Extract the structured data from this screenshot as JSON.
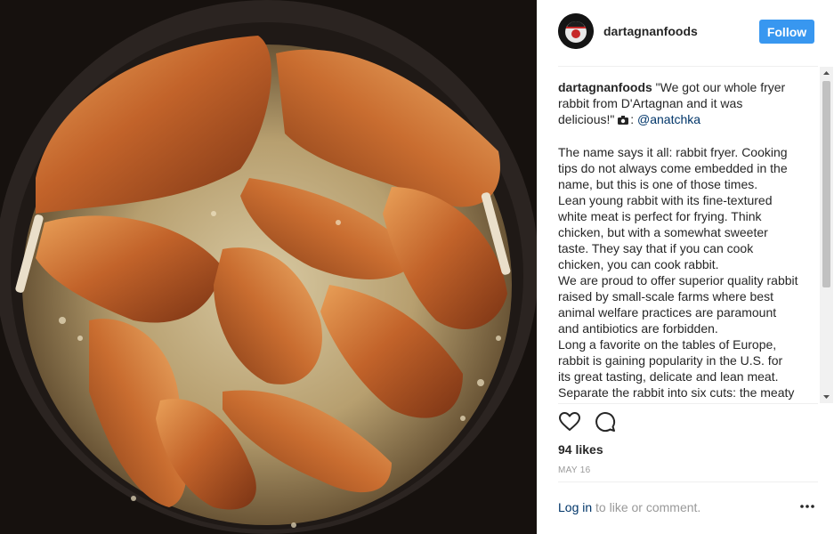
{
  "post": {
    "username": "dartagnanfoods",
    "follow_label": "Follow",
    "caption_user": "dartagnanfoods",
    "caption_quote": " \"We got our whole fryer rabbit from D'Artagnan and it was delicious!\" ",
    "caption_mention": "@anatchka",
    "caption_body": "The name says it all: rabbit fryer. Cooking tips do not always come embedded in the name, but this is one of those times.\nLean young rabbit with its fine-textured white meat is perfect for frying. Think chicken, but with a somewhat sweeter taste. They say that if you can cook chicken, you can cook rabbit.\nWe are proud to offer superior quality rabbit raised by small-scale farms where best animal welfare practices are paramount and antibiotics are forbidden.\nLong a favorite on the tables of Europe, rabbit is gaining popularity in the U.S. for its great tasting, delicate and lean meat.\nSeparate the rabbit into six cuts: the meaty hind legs, smaller front legs, and two halves of the saddle.",
    "likes": "94 likes",
    "date": "MAY 16",
    "login_link": "Log in",
    "login_text": " to like or comment.",
    "more_label": "..."
  },
  "icons": {
    "heart": "heart-icon",
    "comment": "comment-icon",
    "camera": "camera-icon",
    "more": "more-options-icon"
  },
  "colors": {
    "follow_button": "#3897f0",
    "link": "#003569",
    "muted": "#999999"
  }
}
